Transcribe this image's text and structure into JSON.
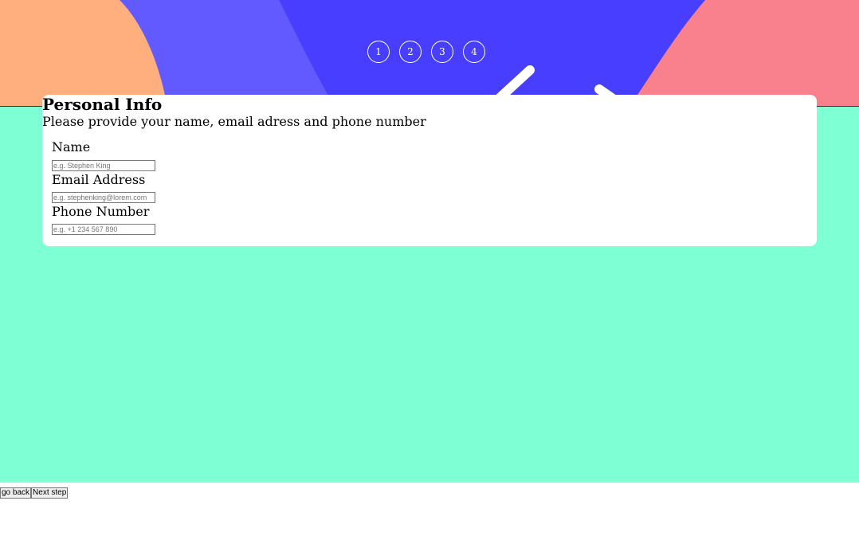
{
  "steps": [
    "1",
    "2",
    "3",
    "4"
  ],
  "form": {
    "title": "Personal Info",
    "subtitle": "Please provide your name, email adress and phone number",
    "fields": [
      {
        "label": "Name",
        "placeholder": "e.g. Stephen King"
      },
      {
        "label": "Email Address",
        "placeholder": "e.g. stephenking@lorem.com"
      },
      {
        "label": "Phone Number",
        "placeholder": "e.g. +1 234 567 890"
      }
    ]
  },
  "actions": {
    "back_label": "go back",
    "next_label": "Next step"
  },
  "colors": {
    "main_background": "#7fffd4",
    "header_orange": "#ffaf7e",
    "header_violet": "#6259ff",
    "header_blue": "#483eff",
    "header_pink": "#f9818e",
    "card": "#ffffff"
  }
}
